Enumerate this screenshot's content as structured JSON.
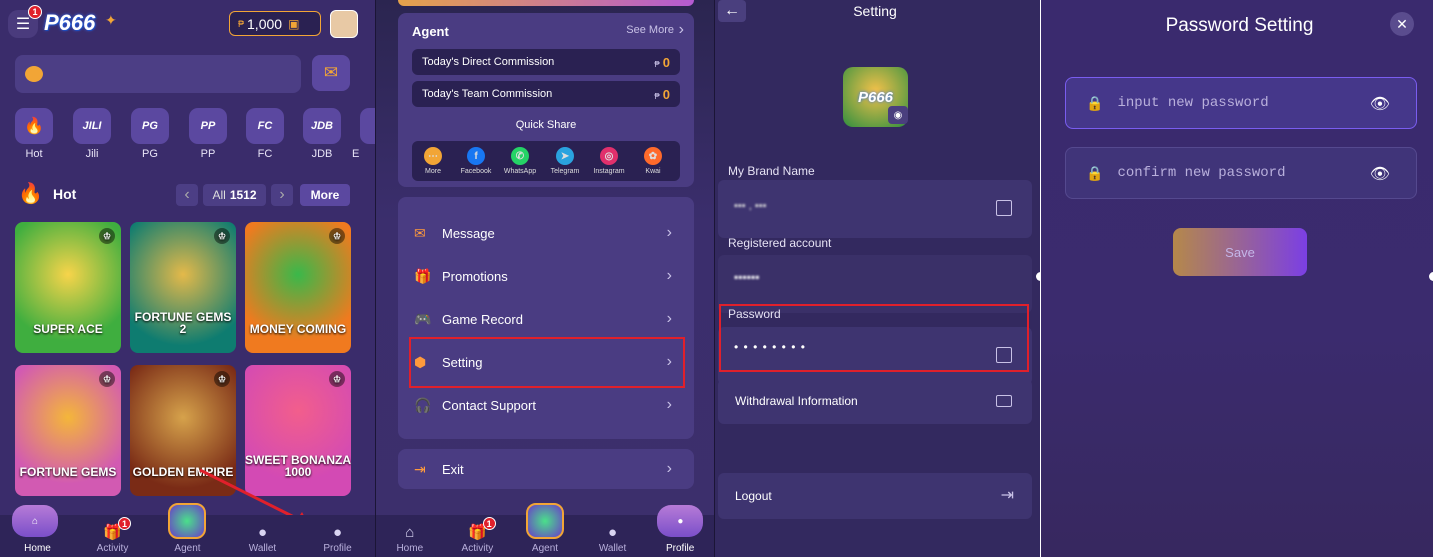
{
  "panel1": {
    "menu_badge": "1",
    "logo": "P666",
    "balance": "1,000",
    "currency": "₱",
    "providers": [
      {
        "abbr": "🔥",
        "label": "Hot"
      },
      {
        "abbr": "JILI",
        "label": "Jili"
      },
      {
        "abbr": "PG",
        "label": "PG"
      },
      {
        "abbr": "PP",
        "label": "PP"
      },
      {
        "abbr": "FC",
        "label": "FC"
      },
      {
        "abbr": "JDB",
        "label": "JDB"
      },
      {
        "abbr": "",
        "label": "E"
      }
    ],
    "section_title": "Hot",
    "all_label": "All",
    "all_count": "1512",
    "more_label": "More",
    "games": [
      "SUPER ACE",
      "FORTUNE GEMS 2",
      "MONEY COMING",
      "FORTUNE GEMS",
      "GOLDEN EMPIRE",
      "SWEET BONANZA 1000"
    ],
    "nav": [
      {
        "label": "Home"
      },
      {
        "label": "Activity",
        "badge": "1"
      },
      {
        "label": "Agent"
      },
      {
        "label": "Wallet"
      },
      {
        "label": "Profile"
      }
    ]
  },
  "panel2": {
    "agent_title": "Agent",
    "see_more": "See More",
    "direct_commission_label": "Today's Direct Commission",
    "direct_commission_value": "0",
    "team_commission_label": "Today's Team Commission",
    "team_commission_value": "0",
    "currency": "₱",
    "quick_share": "Quick Share",
    "share_targets": [
      "More",
      "Facebook",
      "WhatsApp",
      "Telegram",
      "Instagram",
      "Kwai"
    ],
    "menu": [
      "Message",
      "Promotions",
      "Game Record",
      "Setting",
      "Contact Support"
    ],
    "exit": "Exit",
    "nav": [
      {
        "label": "Home"
      },
      {
        "label": "Activity",
        "badge": "1"
      },
      {
        "label": "Agent"
      },
      {
        "label": "Wallet"
      },
      {
        "label": "Profile"
      }
    ]
  },
  "panel3": {
    "title": "Setting",
    "brand_label": "My Brand Name",
    "brand_value": "▪▪▪ , ▪▪▪",
    "registered_label": "Registered account",
    "registered_value": "▪▪▪▪▪▪",
    "password_label": "Password",
    "password_value": "• • • • • • • •",
    "withdrawal": "Withdrawal Information",
    "logout": "Logout"
  },
  "panel4": {
    "title": "Password Setting",
    "new_placeholder": "input new password",
    "confirm_placeholder": "confirm new password",
    "save": "Save"
  },
  "colors": {
    "accent": "#f2a536",
    "highlight": "#e0202b",
    "purple": "#7b3fe4"
  }
}
